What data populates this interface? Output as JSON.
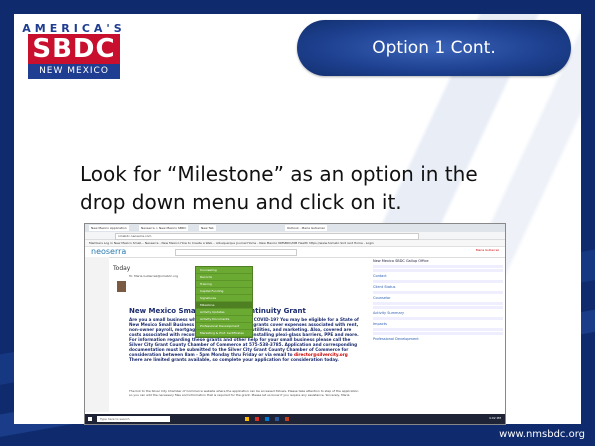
{
  "logo": {
    "line1": "AMERICA'S",
    "line2": "SBDC",
    "line3": "NEW MEXICO"
  },
  "heading": "Option 1 Cont.",
  "body_text": "Look for “Milestone” as an option in the drop down menu and click on it.",
  "footer_url": "www.nmsbdc.org",
  "screenshot": {
    "tabs": [
      "New Mexico Application",
      "Neoserra > New Mexico SBDC",
      "New Tab",
      "Outlook - Maria Gutierrez"
    ],
    "url": "nmsbdc.neoserra.com",
    "bookmarks": "Members Log in   New Mexico Small...   Neoserra - New Mexico   How to Create a Web...   Albuquerque Journal   Home - New Mexico   NMSBDC/NM Health   https://www.hometo   Sixt rent   Home - Login",
    "app_name": "neoserra",
    "user": "Maria Gutierrez",
    "today": "Today",
    "mail_header": "To: Maria Gutierrez@nmsbdc.org",
    "email_title": "New Mexico Small Business Continuity Grant",
    "email_body": "Are you a small business who has been impacted by COVID-19? You may be eligible for a State of New Mexico Small Business Continuity Grant. These grants cover expenses associated with rent, non-owner payroll, mortgage payments, insurance, utilities, and marketing. Also, covered are costs associated with reconfiguring physical space, installing plexi-glass barriers, PPE and more. For information regarding these grants and other help for your small business please call the Silver City Grant County Chamber of Commerce at 575-538-3785. Application and corresponding documentation must be submitted to the Silver City Grant County Chamber of Commerce for consideration between 8am - 5pm Monday thru Friday or via email to",
    "email_link": "director@silvercity.org",
    "email_tail": "There are limited grants available, so complete your application for consideration today.",
    "email_small": "The link to the Silver City Chamber of Commerce website where the application can be accessed follows. Please take attention to step of the application so you can add the necessary files and information that is required for the grant. Please let us know if you require any assistance. Sincerely, Maria",
    "menu_items": [
      "Counseling",
      "Records",
      "Training",
      "Capital Funding",
      "Signatures",
      "Milestone",
      "Activity Updates",
      "Activity Documents",
      "Professional Development",
      "Marketing & Prof. Certificates"
    ],
    "right_title": "New Mexico SBDC Gallup Office",
    "right_items": [
      "Contact",
      "Client Status",
      "Counselor",
      "Activity Summary",
      "Impacts",
      "Professional Development"
    ],
    "taskbar_search": "Type here to search",
    "time": "4:02 PM"
  }
}
